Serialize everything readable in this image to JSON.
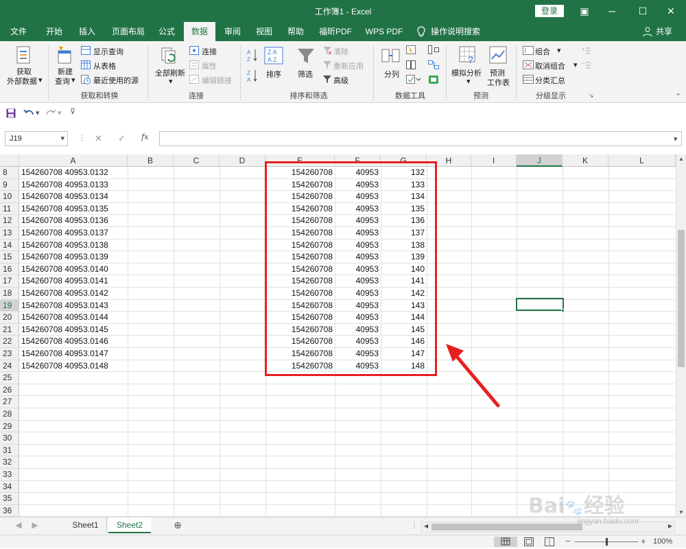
{
  "window": {
    "title": "工作簿1 - Excel",
    "login_label": "登录",
    "minimize_glyph": "─",
    "maximize_glyph": "☐",
    "close_glyph": "✕",
    "restore_glyph": "▣"
  },
  "tabs": [
    {
      "label": "文件"
    },
    {
      "label": "开始"
    },
    {
      "label": "插入"
    },
    {
      "label": "页面布局"
    },
    {
      "label": "公式"
    },
    {
      "label": "数据"
    },
    {
      "label": "审阅"
    },
    {
      "label": "视图"
    },
    {
      "label": "帮助"
    },
    {
      "label": "福昕PDF"
    },
    {
      "label": "WPS PDF"
    },
    {
      "label": "操作说明搜索"
    }
  ],
  "share_label": "共享",
  "ribbon": {
    "get_data": {
      "line1": "获取",
      "line2": "外部数据"
    },
    "new_query": {
      "line1": "新建",
      "line2": "查询"
    },
    "show_query": "显示查询",
    "from_table": "从表格",
    "recent_sources": "最近使用的源",
    "group_get_transform": "获取和转换",
    "refresh_all": "全部刷新",
    "connections": "连接",
    "properties": "属性",
    "edit_links": "编辑链接",
    "group_connections": "连接",
    "sort": "排序",
    "filter": "筛选",
    "clear": "清除",
    "reapply": "重新应用",
    "advanced": "高级",
    "group_sort_filter": "排序和筛选",
    "text_to_columns": "分列",
    "group_data_tools": "数据工具",
    "what_if": "模拟分析",
    "forecast_sheet": {
      "line1": "预测",
      "line2": "工作表"
    },
    "group_forecast": "预测",
    "group_btn": "组合",
    "ungroup_btn": "取消组合",
    "subtotal": "分类汇总",
    "group_outline": "分级显示"
  },
  "name_box": "J19",
  "fx_label": "fx",
  "columns": [
    "A",
    "B",
    "C",
    "D",
    "E",
    "F",
    "G",
    "H",
    "I",
    "J",
    "K",
    "L"
  ],
  "selected_column": "J",
  "selected_row": "19",
  "rows": [
    {
      "num": "8",
      "a": "154260708 40953.0132",
      "e": "154260708",
      "f": "40953",
      "g": "132"
    },
    {
      "num": "9",
      "a": "154260708 40953.0133",
      "e": "154260708",
      "f": "40953",
      "g": "133"
    },
    {
      "num": "10",
      "a": "154260708 40953.0134",
      "e": "154260708",
      "f": "40953",
      "g": "134"
    },
    {
      "num": "11",
      "a": "154260708 40953.0135",
      "e": "154260708",
      "f": "40953",
      "g": "135"
    },
    {
      "num": "12",
      "a": "154260708 40953.0136",
      "e": "154260708",
      "f": "40953",
      "g": "136"
    },
    {
      "num": "13",
      "a": "154260708 40953.0137",
      "e": "154260708",
      "f": "40953",
      "g": "137"
    },
    {
      "num": "14",
      "a": "154260708 40953.0138",
      "e": "154260708",
      "f": "40953",
      "g": "138"
    },
    {
      "num": "15",
      "a": "154260708 40953.0139",
      "e": "154260708",
      "f": "40953",
      "g": "139"
    },
    {
      "num": "16",
      "a": "154260708 40953.0140",
      "e": "154260708",
      "f": "40953",
      "g": "140"
    },
    {
      "num": "17",
      "a": "154260708 40953.0141",
      "e": "154260708",
      "f": "40953",
      "g": "141"
    },
    {
      "num": "18",
      "a": "154260708 40953.0142",
      "e": "154260708",
      "f": "40953",
      "g": "142"
    },
    {
      "num": "19",
      "a": "154260708 40953.0143",
      "e": "154260708",
      "f": "40953",
      "g": "143"
    },
    {
      "num": "20",
      "a": "154260708 40953.0144",
      "e": "154260708",
      "f": "40953",
      "g": "144"
    },
    {
      "num": "21",
      "a": "154260708 40953.0145",
      "e": "154260708",
      "f": "40953",
      "g": "145"
    },
    {
      "num": "22",
      "a": "154260708 40953.0146",
      "e": "154260708",
      "f": "40953",
      "g": "146"
    },
    {
      "num": "23",
      "a": "154260708 40953.0147",
      "e": "154260708",
      "f": "40953",
      "g": "147"
    },
    {
      "num": "24",
      "a": "154260708 40953.0148",
      "e": "154260708",
      "f": "40953",
      "g": "148"
    },
    {
      "num": "25",
      "a": "",
      "e": "",
      "f": "",
      "g": ""
    },
    {
      "num": "26",
      "a": "",
      "e": "",
      "f": "",
      "g": ""
    },
    {
      "num": "27",
      "a": "",
      "e": "",
      "f": "",
      "g": ""
    },
    {
      "num": "28",
      "a": "",
      "e": "",
      "f": "",
      "g": ""
    },
    {
      "num": "29",
      "a": "",
      "e": "",
      "f": "",
      "g": ""
    },
    {
      "num": "30",
      "a": "",
      "e": "",
      "f": "",
      "g": ""
    },
    {
      "num": "31",
      "a": "",
      "e": "",
      "f": "",
      "g": ""
    },
    {
      "num": "32",
      "a": "",
      "e": "",
      "f": "",
      "g": ""
    },
    {
      "num": "33",
      "a": "",
      "e": "",
      "f": "",
      "g": ""
    },
    {
      "num": "34",
      "a": "",
      "e": "",
      "f": "",
      "g": ""
    },
    {
      "num": "35",
      "a": "",
      "e": "",
      "f": "",
      "g": ""
    },
    {
      "num": "36",
      "a": "",
      "e": "",
      "f": "",
      "g": ""
    }
  ],
  "sheets": [
    {
      "label": "Sheet1"
    },
    {
      "label": "Sheet2"
    }
  ],
  "active_sheet": "Sheet2",
  "zoom": "100%",
  "watermark": {
    "line1": "Bai",
    "line2": "经验",
    "url": "jingyan.baidu.com"
  },
  "colors": {
    "accent": "#217346",
    "annotation": "#e62020"
  }
}
